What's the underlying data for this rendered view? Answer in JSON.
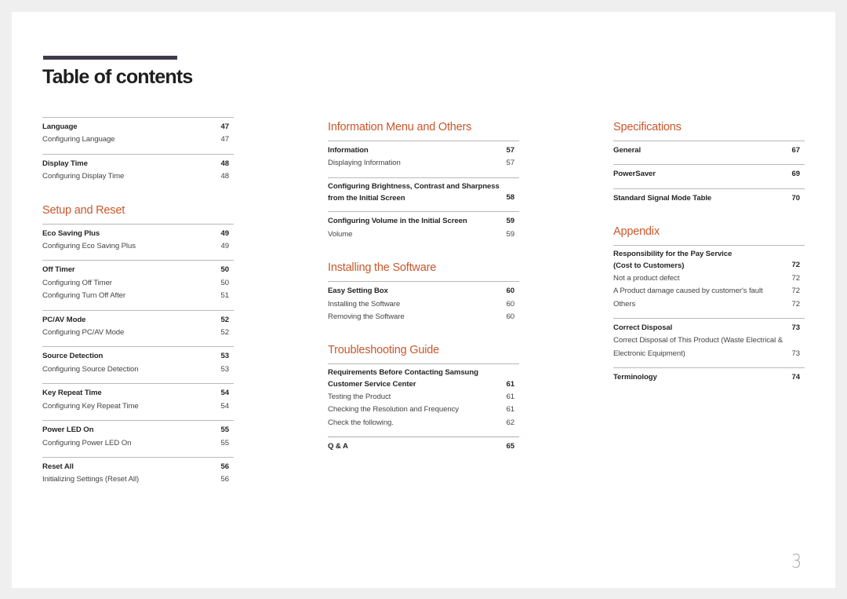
{
  "title": "Table of contents",
  "page_number": "3",
  "colors": {
    "heading": "#c9572b",
    "title_bar": "#403a4f",
    "background": "#efefef"
  },
  "columns": [
    {
      "sections": [
        {
          "heading": null,
          "groups": [
            {
              "title": "Language",
              "page": "47",
              "items": [
                {
                  "label": "Configuring Language",
                  "page": "47"
                }
              ]
            },
            {
              "title": "Display Time",
              "page": "48",
              "items": [
                {
                  "label": "Configuring Display Time",
                  "page": "48"
                }
              ]
            }
          ]
        },
        {
          "heading": "Setup and Reset",
          "groups": [
            {
              "title": "Eco Saving Plus",
              "page": "49",
              "items": [
                {
                  "label": "Configuring Eco Saving Plus",
                  "page": "49"
                }
              ]
            },
            {
              "title": "Off Timer",
              "page": "50",
              "items": [
                {
                  "label": "Configuring Off Timer",
                  "page": "50"
                },
                {
                  "label": "Configuring Turn Off After",
                  "page": "51"
                }
              ]
            },
            {
              "title": "PC/AV Mode",
              "page": "52",
              "items": [
                {
                  "label": "Configuring PC/AV Mode",
                  "page": "52"
                }
              ]
            },
            {
              "title": "Source Detection",
              "page": "53",
              "items": [
                {
                  "label": "Configuring Source Detection",
                  "page": "53"
                }
              ]
            },
            {
              "title": "Key Repeat Time",
              "page": "54",
              "items": [
                {
                  "label": "Configuring Key Repeat Time",
                  "page": "54"
                }
              ]
            },
            {
              "title": "Power LED On",
              "page": "55",
              "items": [
                {
                  "label": "Configuring Power LED On",
                  "page": "55"
                }
              ]
            },
            {
              "title": "Reset All",
              "page": "56",
              "items": [
                {
                  "label": "Initializing Settings (Reset All)",
                  "page": "56"
                }
              ]
            }
          ]
        }
      ]
    },
    {
      "sections": [
        {
          "heading": "Information Menu and Others",
          "groups": [
            {
              "title": "Information",
              "page": "57",
              "items": [
                {
                  "label": "Displaying Information",
                  "page": "57"
                }
              ]
            },
            {
              "title": "Configuring Brightness, Contrast and Sharpness\nfrom the Initial Screen",
              "page": "58",
              "items": []
            },
            {
              "title": "Configuring Volume in the Initial Screen",
              "page": "59",
              "items": [
                {
                  "label": "Volume",
                  "page": "59"
                }
              ]
            }
          ]
        },
        {
          "heading": "Installing the Software",
          "groups": [
            {
              "title": "Easy Setting Box",
              "page": "60",
              "items": [
                {
                  "label": "Installing the Software",
                  "page": "60"
                },
                {
                  "label": "Removing the Software",
                  "page": "60"
                }
              ]
            }
          ]
        },
        {
          "heading": "Troubleshooting Guide",
          "groups": [
            {
              "title": "Requirements Before Contacting Samsung\nCustomer Service Center",
              "page": "61",
              "items": [
                {
                  "label": "Testing the Product",
                  "page": "61"
                },
                {
                  "label": "Checking the Resolution and Frequency",
                  "page": "61"
                },
                {
                  "label": "Check the following.",
                  "page": "62"
                }
              ]
            },
            {
              "title": "Q & A",
              "page": "65",
              "items": [],
              "accent": "purple"
            }
          ]
        }
      ]
    },
    {
      "sections": [
        {
          "heading": "Specifications",
          "groups": [
            {
              "title": "General",
              "page": "67",
              "items": []
            },
            {
              "title": "PowerSaver",
              "page": "69",
              "items": []
            },
            {
              "title": "Standard Signal Mode Table",
              "page": "70",
              "items": []
            }
          ]
        },
        {
          "heading": "Appendix",
          "groups": [
            {
              "title": "Responsibility for the Pay Service\n(Cost to Customers)",
              "page": "72",
              "items": [
                {
                  "label": "Not a product defect",
                  "page": "72"
                },
                {
                  "label": "A Product damage caused by customer's fault",
                  "page": "72"
                },
                {
                  "label": "Others",
                  "page": "72"
                }
              ]
            },
            {
              "title": "Correct Disposal",
              "page": "73",
              "items": [
                {
                  "label": "Correct Disposal of This Product (Waste Electrical &\nElectronic Equipment)",
                  "page": "73"
                }
              ]
            },
            {
              "title": "Terminology",
              "page": "74",
              "items": []
            }
          ]
        }
      ]
    }
  ]
}
